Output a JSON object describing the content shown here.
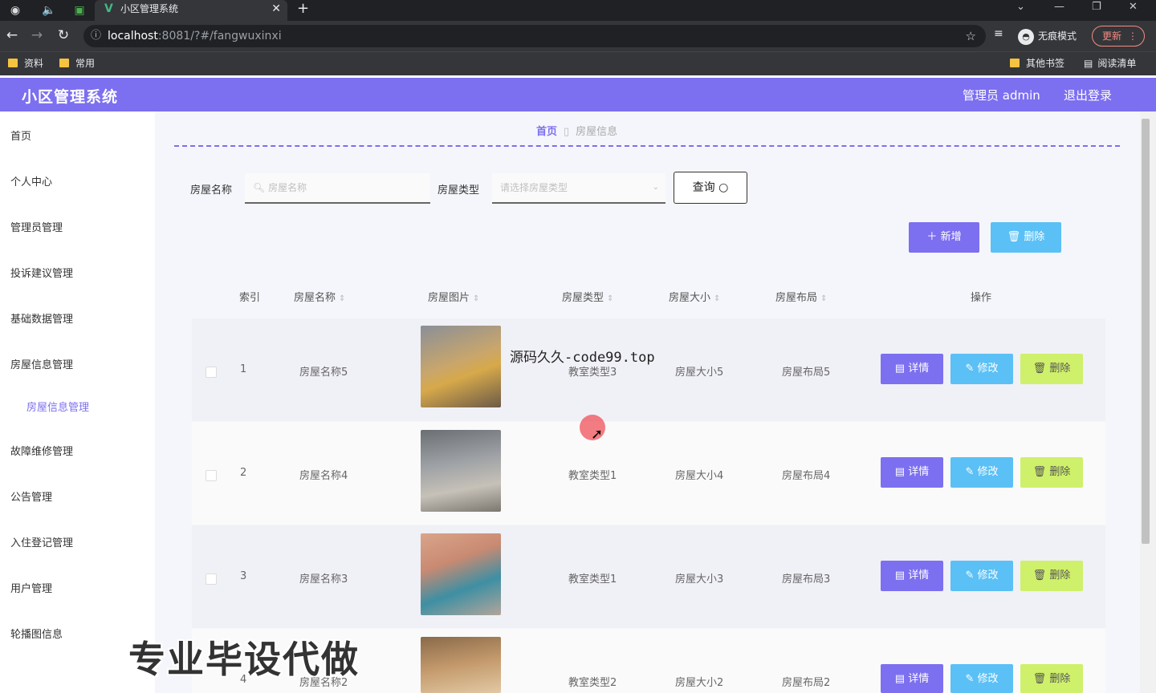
{
  "browser": {
    "tab_title": "小区管理系统",
    "url_host": "localhost",
    "url_path": ":8081/?#/fangwuxinxi",
    "incognito_label": "无痕模式",
    "update_label": "更新",
    "bookmarks": [
      "资料",
      "常用"
    ],
    "bookmarks_right": [
      "其他书签",
      "阅读清单"
    ]
  },
  "header": {
    "title": "小区管理系统",
    "user": "管理员 admin",
    "logout": "退出登录"
  },
  "sidebar": {
    "items": [
      "首页",
      "个人中心",
      "管理员管理",
      "投诉建议管理",
      "基础数据管理",
      "房屋信息管理",
      "房屋信息管理",
      "故障维修管理",
      "公告管理",
      "入住登记管理",
      "用户管理",
      "轮播图信息"
    ]
  },
  "breadcrumb": {
    "home": "首页",
    "current": "房屋信息"
  },
  "search": {
    "name_label": "房屋名称",
    "name_placeholder": "房屋名称",
    "type_label": "房屋类型",
    "type_placeholder": "请选择房屋类型",
    "query_label": "查询"
  },
  "actions": {
    "add": "新增",
    "delete": "删除"
  },
  "table": {
    "headers": [
      "索引",
      "房屋名称",
      "房屋图片",
      "房屋类型",
      "房屋大小",
      "房屋布局",
      "操作"
    ],
    "rows": [
      {
        "index": "1",
        "name": "房屋名称5",
        "type": "教室类型3",
        "size": "房屋大小5",
        "layout": "房屋布局5"
      },
      {
        "index": "2",
        "name": "房屋名称4",
        "type": "教室类型1",
        "size": "房屋大小4",
        "layout": "房屋布局4"
      },
      {
        "index": "3",
        "name": "房屋名称3",
        "type": "教室类型1",
        "size": "房屋大小3",
        "layout": "房屋布局3"
      },
      {
        "index": "4",
        "name": "房屋名称2",
        "type": "教室类型2",
        "size": "房屋大小2",
        "layout": "房屋布局2"
      }
    ],
    "ops": {
      "detail": "详情",
      "edit": "修改",
      "delete": "删除"
    }
  },
  "overlays": {
    "watermark": "源码久久-code99.top",
    "banner": "专业毕设代做"
  },
  "colors": {
    "accent": "#7c6ff0",
    "info": "#5bc0f5",
    "lime": "#cff06a"
  }
}
